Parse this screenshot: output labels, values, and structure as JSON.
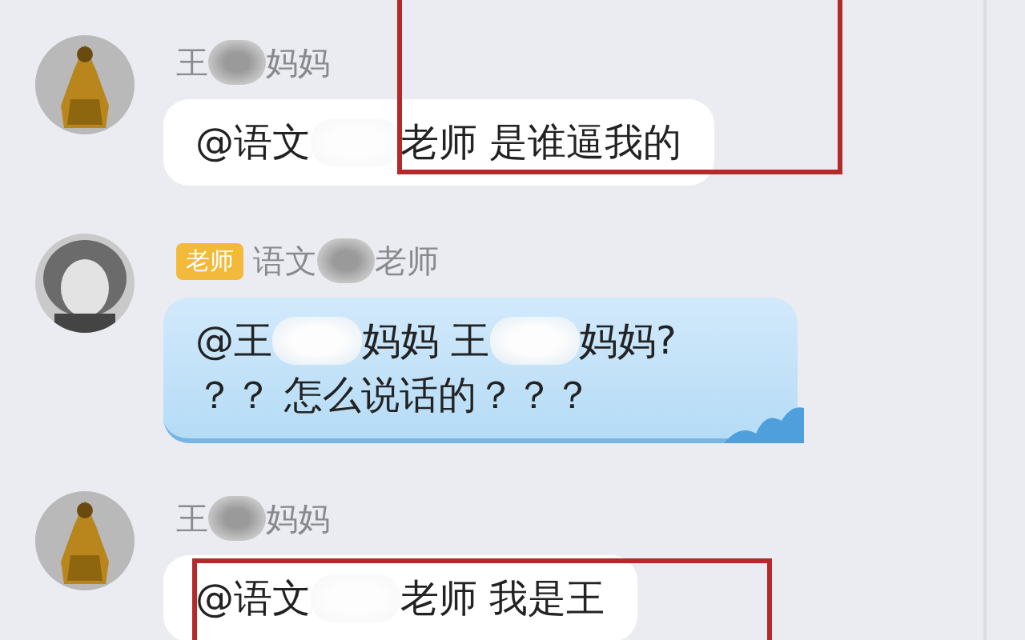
{
  "messages": [
    {
      "sender": [
        {
          "text": "王"
        },
        {
          "kind": "blur"
        },
        {
          "text": "妈妈"
        }
      ],
      "kind": "white",
      "highlighted": true,
      "lines": [
        [
          {
            "text": "@语文"
          },
          {
            "kind": "blur"
          },
          {
            "text": "老师 是谁逼我的"
          }
        ]
      ]
    },
    {
      "badge": "老师",
      "sender": [
        {
          "text": "语文"
        },
        {
          "kind": "blur"
        },
        {
          "text": "老师"
        }
      ],
      "kind": "blue",
      "highlighted": false,
      "lines": [
        [
          {
            "text": "@王"
          },
          {
            "kind": "blur"
          },
          {
            "text": "妈妈 王"
          },
          {
            "kind": "blur"
          },
          {
            "text": "妈妈?"
          }
        ],
        [
          {
            "text": "？？ 怎么说话的？？？"
          }
        ]
      ]
    },
    {
      "sender": [
        {
          "text": "王"
        },
        {
          "kind": "blur"
        },
        {
          "text": "妈妈"
        }
      ],
      "kind": "white",
      "highlighted": true,
      "lines": [
        [
          {
            "text": "@语文"
          },
          {
            "kind": "blur"
          },
          {
            "text": "老师 我是王"
          }
        ]
      ]
    }
  ]
}
